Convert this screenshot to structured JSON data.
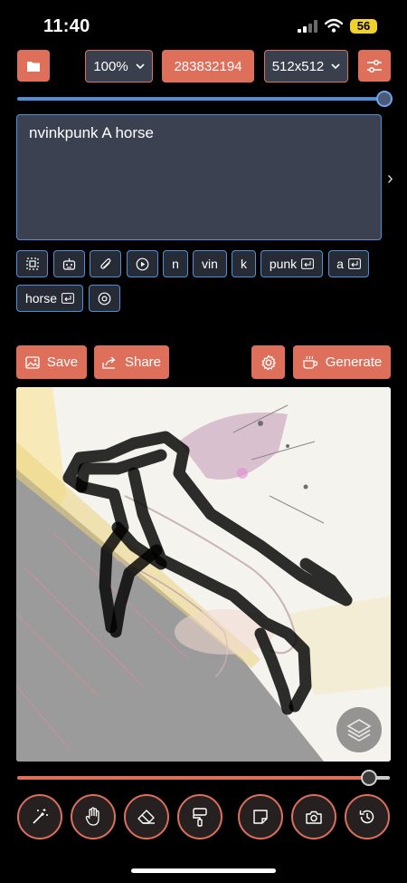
{
  "status": {
    "time": "11:40",
    "battery": "56"
  },
  "toolbar": {
    "zoom": "100%",
    "seed": "283832194",
    "size": "512x512"
  },
  "prompt": {
    "text": "nvinkpunk A horse"
  },
  "tokens": {
    "row1": [
      "n",
      "vin",
      "k",
      "punk",
      "a"
    ],
    "row2": [
      "horse"
    ]
  },
  "actions": {
    "save": "Save",
    "share": "Share",
    "generate": "Generate"
  },
  "sliders": {
    "top_value": 1.0,
    "bottom_value": 0.94
  },
  "icons": {
    "toolbar": [
      "folder-icon",
      "chevron-down-icon",
      "sliders-icon"
    ],
    "chips": [
      "select-region-icon",
      "robot-icon",
      "paperclip-icon",
      "play-icon",
      "return-icon",
      "target-icon"
    ],
    "actions": [
      "image-icon",
      "share-icon",
      "gear-icon",
      "coffee-icon"
    ],
    "tools": [
      "magic-wand-icon",
      "hand-icon",
      "eraser-icon",
      "paint-roller-icon",
      "sticky-note-icon",
      "camera-icon",
      "history-icon",
      "layers-icon"
    ]
  },
  "colors": {
    "accent": "#dd6f5b",
    "focus": "#4f8fd6",
    "field": "#3b4150"
  }
}
